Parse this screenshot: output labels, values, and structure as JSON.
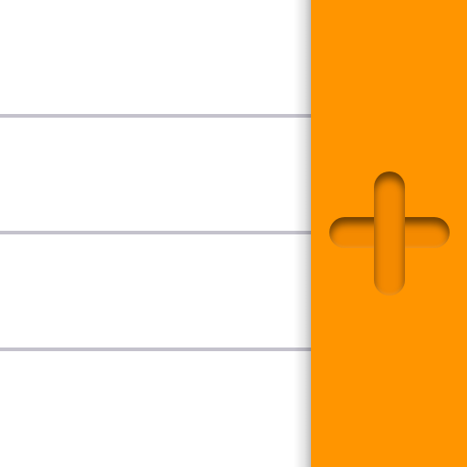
{
  "app": {
    "name": "",
    "icon": "notes-with-add-tab"
  },
  "paper": {
    "background": "#ffffff",
    "rule_color": "#c4c2cc",
    "rule_count": 3
  },
  "add_tab": {
    "icon": "plus-icon",
    "background": "#ff9500",
    "icon_color": "#f48a00"
  }
}
